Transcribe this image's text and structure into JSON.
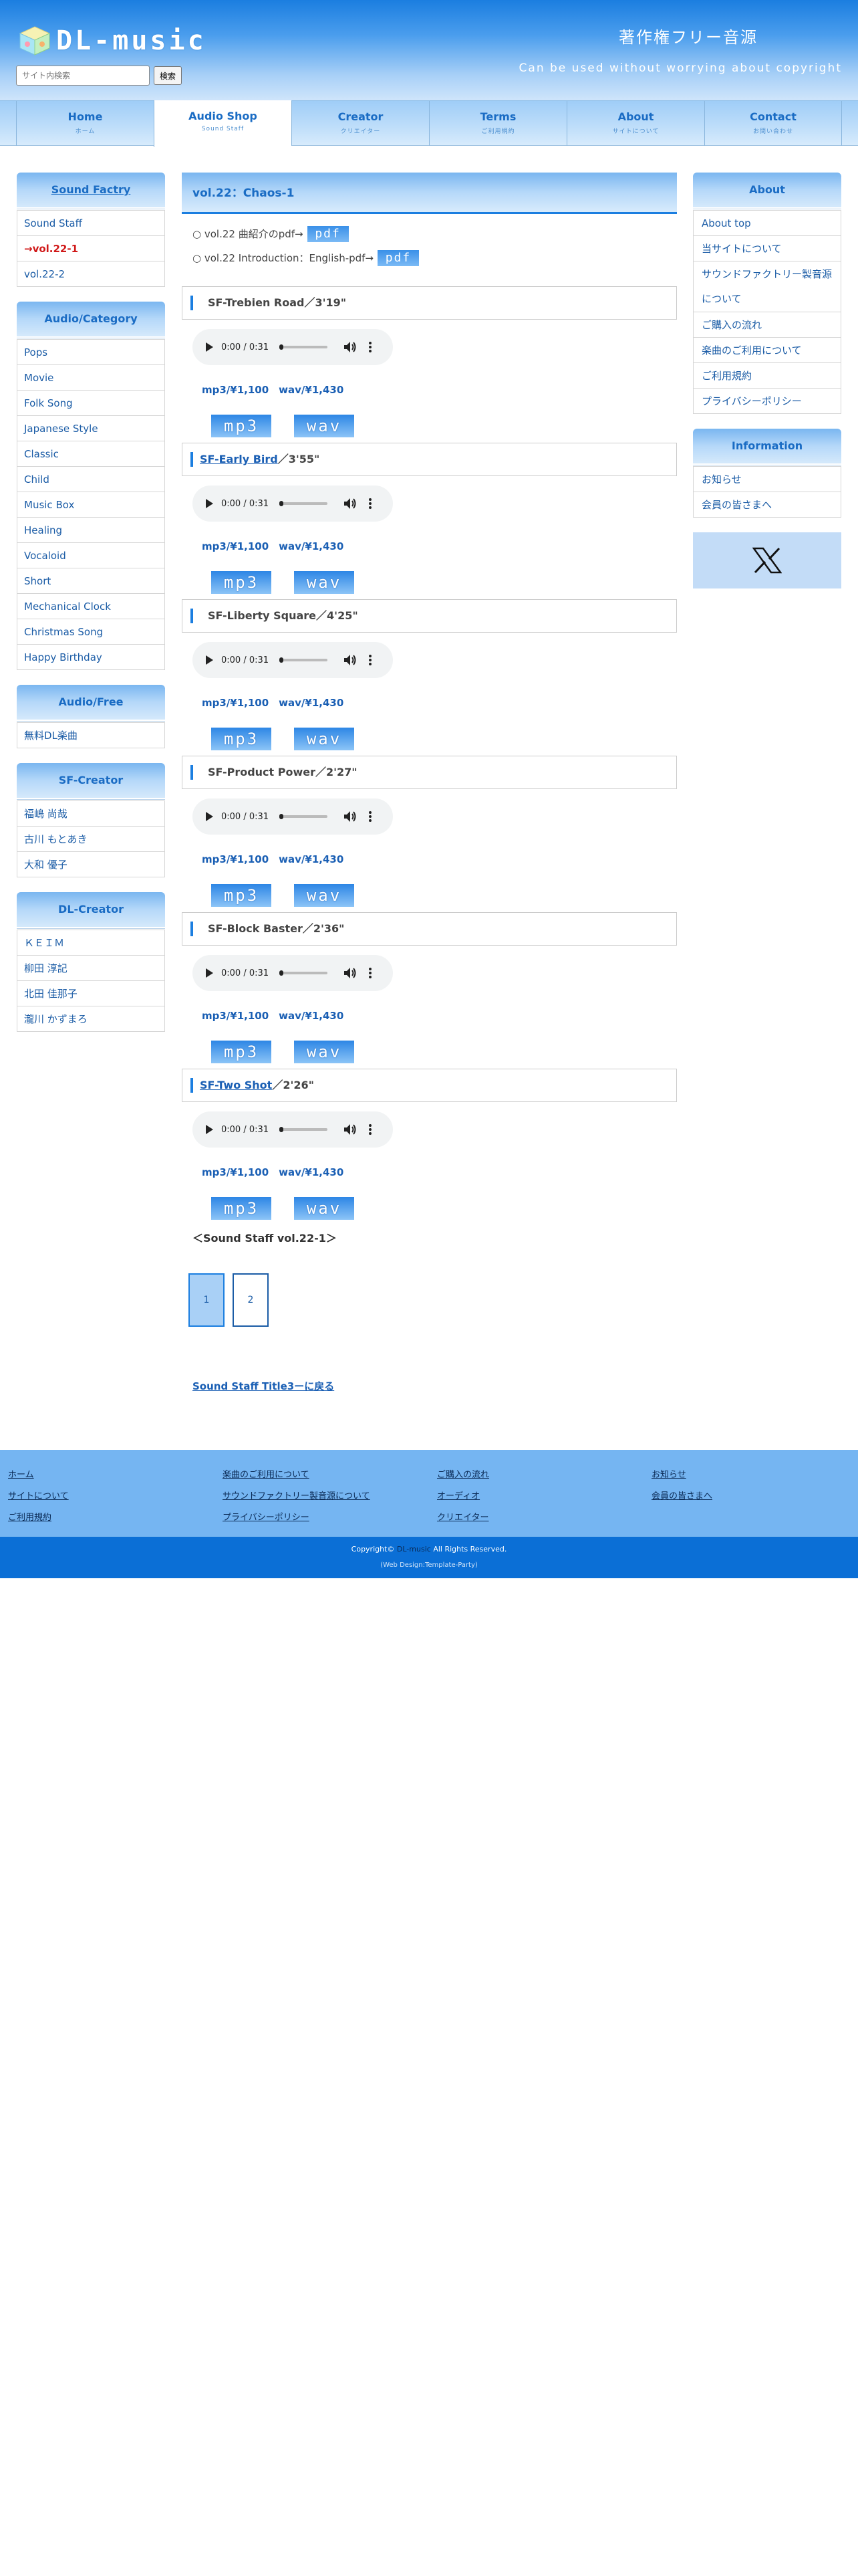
{
  "header": {
    "logo_text": "DL-music",
    "title": "著作権フリー音源",
    "subtitle": "Can be used without worrying about copyright",
    "search_placeholder": "サイト内検索",
    "search_button": "検索"
  },
  "nav": [
    {
      "label": "Home",
      "sub": "ホーム"
    },
    {
      "label": "Audio Shop",
      "sub": "Sound Staff"
    },
    {
      "label": "Creator",
      "sub": "クリエイター"
    },
    {
      "label": "Terms",
      "sub": "ご利用規約"
    },
    {
      "label": "About",
      "sub": "サイトについて"
    },
    {
      "label": "Contact",
      "sub": "お問い合わせ"
    }
  ],
  "left_sidebar": {
    "sound_factory": {
      "title": "Sound Factry",
      "items": [
        "Sound Staff",
        "→vol.22-1",
        "vol.22-2"
      ]
    },
    "category": {
      "title": "Audio/Category",
      "items": [
        "Pops",
        "Movie",
        "Folk Song",
        "Japanese Style",
        "Classic",
        "Child",
        "Music Box",
        "Healing",
        "Vocaloid",
        "Short",
        "Mechanical Clock",
        "Christmas Song",
        "Happy Birthday"
      ]
    },
    "free": {
      "title": "Audio/Free",
      "items": [
        "無料DL楽曲"
      ]
    },
    "sf_creator": {
      "title": "SF-Creator",
      "items": [
        "福嶋 尚哉",
        "古川 もとあき",
        "大和 優子"
      ]
    },
    "dl_creator": {
      "title": "DL-Creator",
      "items": [
        "ＫＥＩＭ",
        "柳田 淳記",
        "北田 佳那子",
        "瀧川 かずまろ"
      ]
    }
  },
  "right_sidebar": {
    "about": {
      "title": "About",
      "items": [
        "About top",
        "当サイトについて",
        "サウンドファクトリー製音源",
        "について",
        "ご購入の流れ",
        "楽曲のご利用について",
        "ご利用規約",
        "プライバシーポリシー"
      ]
    },
    "information": {
      "title": "Information",
      "items": [
        "お知らせ",
        "会員の皆さまへ"
      ]
    },
    "x_icon": "x-logo"
  },
  "main": {
    "title": "vol.22：Chaos-1",
    "pdf_lines": [
      {
        "label": "○ vol.22 曲紹介のpdf→",
        "button": "pdf"
      },
      {
        "label": "○ vol.22 Introduction：English-pdf→",
        "button": "pdf"
      }
    ],
    "tracks": [
      {
        "prefix": "SF-Trebien Road",
        "suffix": "／3'19\"",
        "link": false
      },
      {
        "prefix": "SF-Early Bird",
        "suffix": "／3'55\"",
        "link": true
      },
      {
        "prefix": "SF-Liberty Square",
        "suffix": "／4'25\"",
        "link": false
      },
      {
        "prefix": "SF-Product Power",
        "suffix": "／2'27\"",
        "link": false
      },
      {
        "prefix": "SF-Block Baster",
        "suffix": "／2'36\"",
        "link": false
      },
      {
        "prefix": "SF-Two Shot",
        "suffix": "／2'26\"",
        "link": true
      }
    ],
    "player_time": "0:00 / 0:31",
    "price": "mp3/¥1,100　wav/¥1,430",
    "mp3_button": "mp3",
    "wav_button": "wav",
    "vol_label": "＜Sound Staff vol.22-1＞",
    "pages": [
      "1",
      "2"
    ],
    "back_link": "Sound Staff Title3ーに戻る"
  },
  "footer": {
    "columns": [
      [
        "ホーム",
        "サイトについて",
        "ご利用規約"
      ],
      [
        "楽曲のご利用について",
        "サウンドファクトリー製音源について",
        "プライバシーポリシー"
      ],
      [
        "ご購入の流れ",
        "オーディオ",
        "クリエイター"
      ],
      [
        "お知らせ",
        "会員の皆さまへ"
      ]
    ],
    "copyright_pre": "Copyright©",
    "copyright_site": "DL-music",
    "copyright_post": "All Rights Reserved.",
    "credit": "(Web Design:Template-Party)"
  },
  "colors": {
    "accent": "#1b7ee0",
    "link": "#1a5fb4",
    "current": "#d01818",
    "footer": "#75b5f2",
    "footer_bottom": "#0b6fd6"
  }
}
